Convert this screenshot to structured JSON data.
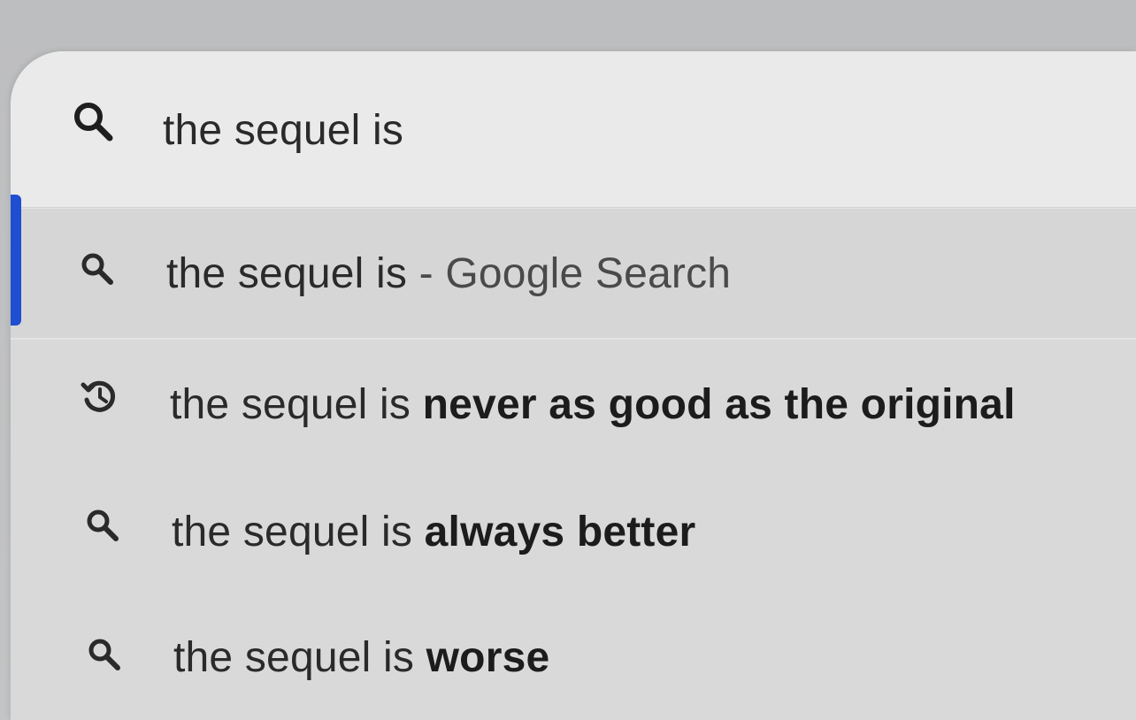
{
  "omnibox": {
    "icon": "search-icon",
    "query": "the sequel is"
  },
  "suggestions": [
    {
      "icon": "search-icon",
      "prefix": "the sequel is",
      "completion": "",
      "secondary": " - Google Search",
      "selected": true
    },
    {
      "icon": "history-icon",
      "prefix": "the sequel is",
      "completion": " never as good as the original",
      "secondary": "",
      "selected": false
    },
    {
      "icon": "search-icon",
      "prefix": "the sequel is",
      "completion": " always better",
      "secondary": "",
      "selected": false
    },
    {
      "icon": "search-icon",
      "prefix": "the sequel is",
      "completion": " worse",
      "secondary": "",
      "selected": false
    }
  ],
  "colors": {
    "selection_accent": "#1f4fd0",
    "background": "#e4e4e4",
    "text": "#2a2a2a"
  }
}
